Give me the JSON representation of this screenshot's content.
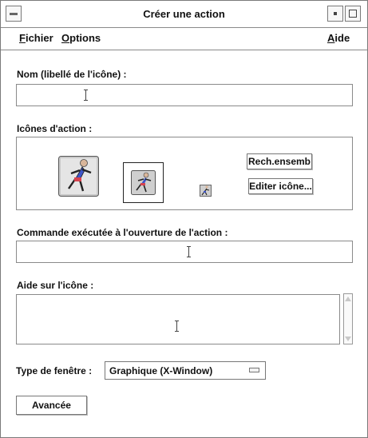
{
  "window": {
    "title": "Créer une action"
  },
  "menu": {
    "left": [
      {
        "prefix": "F",
        "rest": "ichier"
      },
      {
        "prefix": "O",
        "rest": "ptions"
      }
    ],
    "right": {
      "prefix": "A",
      "rest": "ide"
    }
  },
  "form": {
    "name_label": "Nom (libellé de l'icône) :",
    "name_value": "",
    "icons_label": "Icônes d'action :",
    "find_set_button": "Rech.ensemb",
    "edit_icon_button": "Editer icône...",
    "command_label": "Commande exécutée à l'ouverture de l'action :",
    "command_value": "",
    "help_label": "Aide sur l'icône :",
    "help_value": "",
    "window_type_label": "Type de fenêtre :",
    "window_type_value": "Graphique (X-Window)",
    "advanced_button": "Avancée"
  }
}
